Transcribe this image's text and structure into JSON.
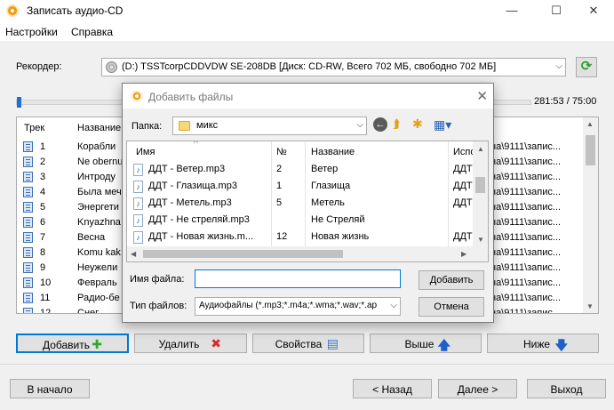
{
  "window": {
    "title": "Записать аудио-CD",
    "controls": {
      "minimize": "—",
      "maximize": "☐",
      "close": "✕"
    }
  },
  "menu": [
    "Настройки",
    "Справка"
  ],
  "recorder": {
    "label": "Рекордер:",
    "value": "(D:) TSSTcorpCDDVDW SE-208DB [Диск: CD-RW, Всего 702 МБ, свободно 702 МБ]",
    "refresh_icon": "refresh-icon"
  },
  "progress": {
    "time": "281:53 / 75:00",
    "fraction": 0.01
  },
  "track_list": {
    "headers": [
      "Трек",
      "Название"
    ],
    "rows": [
      {
        "num": "1",
        "name": "Корабли",
        "path": "на\\9111\\запис..."
      },
      {
        "num": "2",
        "name": "Ne obernu",
        "path": "на\\9111\\запис..."
      },
      {
        "num": "3",
        "name": "Интроду",
        "path": "на\\9111\\запис..."
      },
      {
        "num": "4",
        "name": "Была меч",
        "path": "на\\9111\\запис..."
      },
      {
        "num": "5",
        "name": "Энергети",
        "path": "на\\9111\\запис..."
      },
      {
        "num": "6",
        "name": "Knyazhna",
        "path": "на\\9111\\запис..."
      },
      {
        "num": "7",
        "name": "Весна",
        "path": "на\\9111\\запис..."
      },
      {
        "num": "8",
        "name": "Komu kak",
        "path": "на\\9111\\запис..."
      },
      {
        "num": "9",
        "name": "Неужели",
        "path": "на\\9111\\запис..."
      },
      {
        "num": "10",
        "name": "Февраль",
        "path": "на\\9111\\запис..."
      },
      {
        "num": "11",
        "name": "Радио-бе",
        "path": "на\\9111\\запис..."
      },
      {
        "num": "12",
        "name": "Снег",
        "path": "на\\9111\\запис..."
      }
    ]
  },
  "actions": {
    "add": "Добавить",
    "delete": "Удалить",
    "properties": "Свойства",
    "up": "Выше",
    "down": "Ниже"
  },
  "nav": {
    "start": "В начало",
    "back": "< Назад",
    "next": "Далее >",
    "exit": "Выход"
  },
  "dialog": {
    "title": "Добавить файлы",
    "folder_label": "Папка:",
    "folder_value": "микс",
    "headers": {
      "name": "Имя",
      "num": "№",
      "title": "Название",
      "artist": "Испо"
    },
    "files": [
      {
        "name": "ДДТ - Ветер.mp3",
        "num": "2",
        "title": "Ветер",
        "artist": "ДДТ"
      },
      {
        "name": "ДДТ - Глазища.mp3",
        "num": "1",
        "title": "Глазища",
        "artist": "ДДТ"
      },
      {
        "name": "ДДТ - Метель.mp3",
        "num": "5",
        "title": "Метель",
        "artist": "ДДТ"
      },
      {
        "name": "ДДТ - Не стреляй.mp3",
        "num": "",
        "title": "Не Стреляй",
        "artist": ""
      },
      {
        "name": "ДДТ - Новая жизнь.m...",
        "num": "12",
        "title": "Новая жизнь",
        "artist": "ДДТ"
      }
    ],
    "filename_label": "Имя файла:",
    "filename_value": "",
    "filetype_label": "Тип файлов:",
    "filetype_value": "Аудиофайлы (*.mp3;*.m4a;*.wma;*.wav;*.ap",
    "add_button": "Добавить",
    "cancel_button": "Отмена"
  }
}
